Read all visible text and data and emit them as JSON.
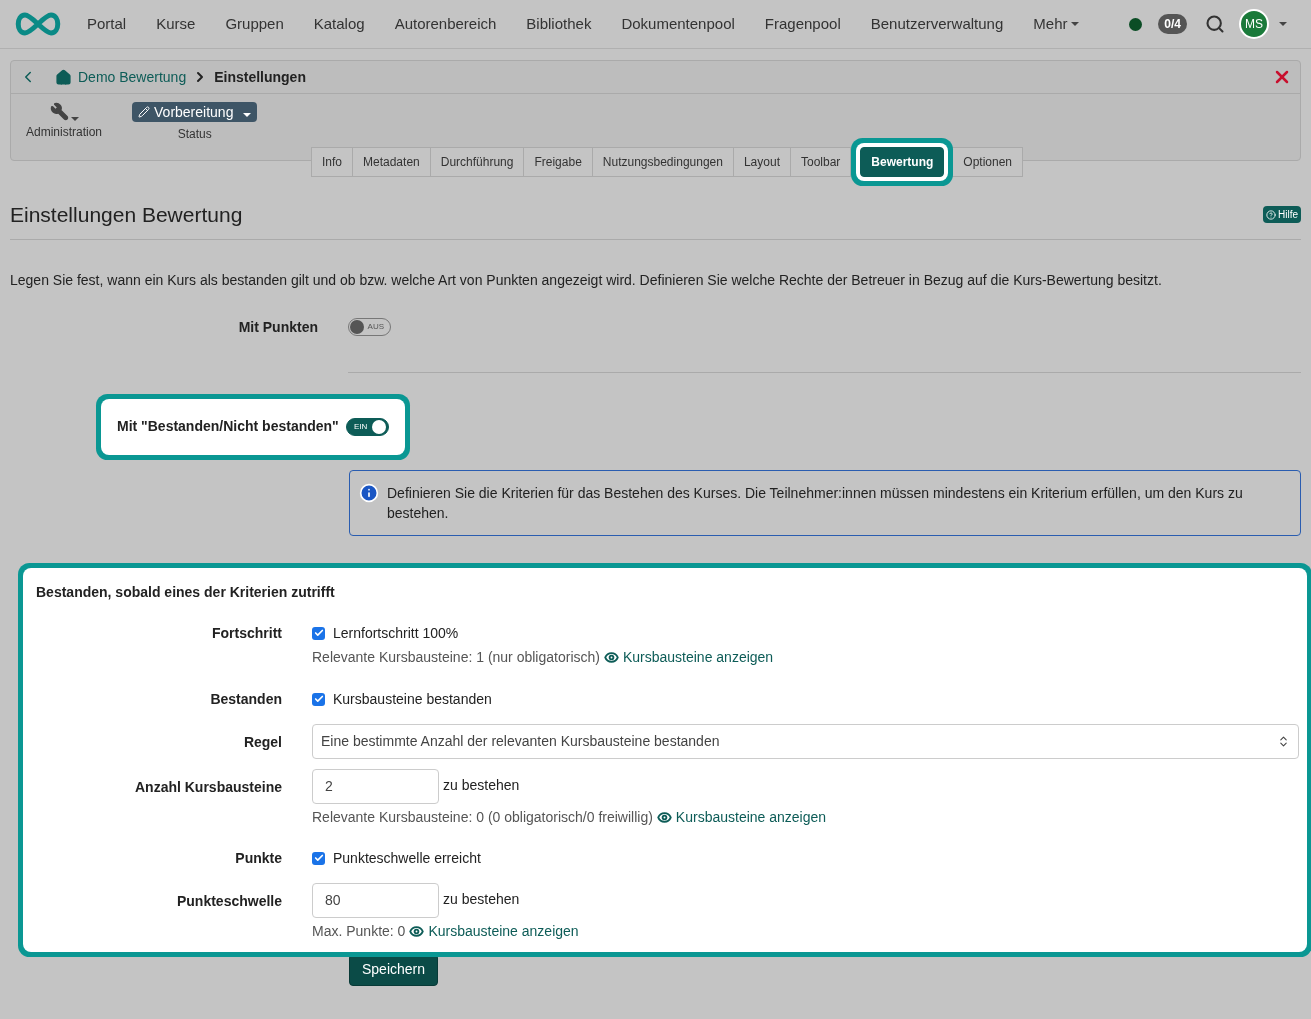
{
  "nav": {
    "items": [
      "Portal",
      "Kurse",
      "Gruppen",
      "Katalog",
      "Autorenbereich",
      "Bibliothek",
      "Dokumentenpool",
      "Fragenpool",
      "Benutzerverwaltung"
    ],
    "more": "Mehr",
    "badge": "0/4",
    "avatar": "MS"
  },
  "breadcrumb": {
    "home": "Demo Bewertung",
    "current": "Einstellungen"
  },
  "toolbar": {
    "admin_label": "Administration",
    "status_button": "Vorbereitung",
    "status_label": "Status"
  },
  "tabs": [
    {
      "label": "Info",
      "selected": false
    },
    {
      "label": "Metadaten",
      "selected": false
    },
    {
      "label": "Durchführung",
      "selected": false
    },
    {
      "label": "Freigabe",
      "selected": false
    },
    {
      "label": "Nutzungsbedingungen",
      "selected": false
    },
    {
      "label": "Layout",
      "selected": false
    },
    {
      "label": "Toolbar",
      "selected": false
    },
    {
      "label": "Bewertung",
      "selected": true
    },
    {
      "label": "Optionen",
      "selected": false
    }
  ],
  "page": {
    "title": "Einstellungen Bewertung",
    "help": "Hilfe",
    "description": "Legen Sie fest, wann ein Kurs als bestanden gilt und ob bzw. welche Art von Punkten angezeigt wird. Definieren Sie welche Rechte der Betreuer in Bezug auf die Kurs-Bewertung besitzt."
  },
  "switches": [
    {
      "label": "Mit Punkten",
      "on": false,
      "text": "AUS",
      "highlighted": false
    },
    {
      "label": "Mit \"Bestanden/Nicht bestanden\"",
      "on": true,
      "text": "EIN",
      "highlighted": true
    }
  ],
  "info": "Definieren Sie die Kriterien für das Bestehen des Kurses. Die Teilnehmer:innen müssen mindestens ein Kriterium erfüllen, um den Kurs zu bestehen.",
  "criteria": {
    "title": "Bestanden, sobald eines der Kriterien zutrifft",
    "highlighted": true,
    "rows": [
      {
        "kind": "checkbox",
        "label": "Fortschritt",
        "option": "Lernfortschritt 100%",
        "checked": true,
        "note": "Relevante Kursbausteine: 1 (nur obligatorisch)",
        "link": "Kursbausteine anzeigen"
      },
      {
        "kind": "checkbox",
        "label": "Bestanden",
        "option": "Kursbausteine bestanden",
        "checked": true
      },
      {
        "kind": "select",
        "label": "Regel",
        "value": "Eine bestimmte Anzahl der relevanten Kursbausteine bestanden"
      },
      {
        "kind": "number",
        "label": "Anzahl Kursbausteine",
        "value": "2",
        "suffix": "zu bestehen",
        "note": "Relevante Kursbausteine: 0 (0 obligatorisch/0 freiwillig)",
        "link": "Kursbausteine anzeigen"
      },
      {
        "kind": "checkbox",
        "label": "Punkte",
        "option": "Punkteschwelle erreicht",
        "checked": true
      },
      {
        "kind": "number",
        "label": "Punkteschwelle",
        "value": "80",
        "suffix": "zu bestehen",
        "note": "Max. Punkte: 0",
        "link": "Kursbausteine anzeigen"
      }
    ]
  },
  "save": "Speichern"
}
